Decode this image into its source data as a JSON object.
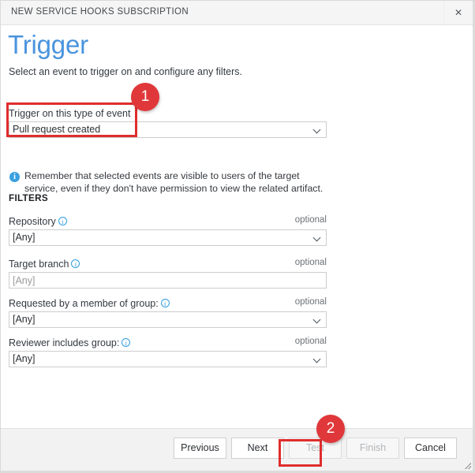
{
  "window": {
    "titlebar_text": "NEW SERVICE HOOKS SUBSCRIPTION",
    "close_icon": "close-icon",
    "close_glyph": "✕"
  },
  "page": {
    "title": "Trigger",
    "subtitle": "Select an event to trigger on and configure any filters."
  },
  "trigger": {
    "label": "Trigger on this type of event",
    "value": "Pull request created",
    "chevron_icon": "chevron-down-icon"
  },
  "info_note": {
    "icon": "info-filled-icon",
    "glyph": "i",
    "text": "Remember that selected events are visible to users of the target service, even if they don't have permission to view the related artifact."
  },
  "filters": {
    "heading": "FILTERS",
    "optional_text": "optional",
    "info_icon": "info-outline-icon",
    "info_glyph": "i",
    "rows": [
      {
        "label": "Repository",
        "has_info": true,
        "control": "select",
        "value": "[Any]",
        "optional": "optional",
        "is_placeholder": false
      },
      {
        "label": "Target branch",
        "has_info": true,
        "control": "text",
        "value": "",
        "placeholder": "[Any]",
        "optional": "optional",
        "is_placeholder": true
      },
      {
        "label": "Requested by a member of group:",
        "has_info": true,
        "control": "select",
        "value": "[Any]",
        "optional": "optional",
        "is_placeholder": false
      },
      {
        "label": "Reviewer includes group:",
        "has_info": true,
        "control": "select",
        "value": "[Any]",
        "optional": "optional",
        "is_placeholder": false
      }
    ]
  },
  "footer": {
    "buttons": [
      {
        "label": "Previous",
        "disabled": false
      },
      {
        "label": "Next",
        "disabled": false
      },
      {
        "label": "Test",
        "disabled": true
      },
      {
        "label": "Finish",
        "disabled": true
      },
      {
        "label": "Cancel",
        "disabled": false
      }
    ]
  },
  "annotations": {
    "badges": [
      {
        "number": "1"
      },
      {
        "number": "2"
      }
    ],
    "callout_color": "#e02d2d",
    "badge_color": "#e0383a"
  },
  "colors": {
    "title_blue": "#4a94dd",
    "info_blue": "#3aa0e0",
    "titlebar_bg": "#f5f5f5",
    "footer_bg": "#f2f2f2",
    "field_border": "#cdcdcd"
  }
}
